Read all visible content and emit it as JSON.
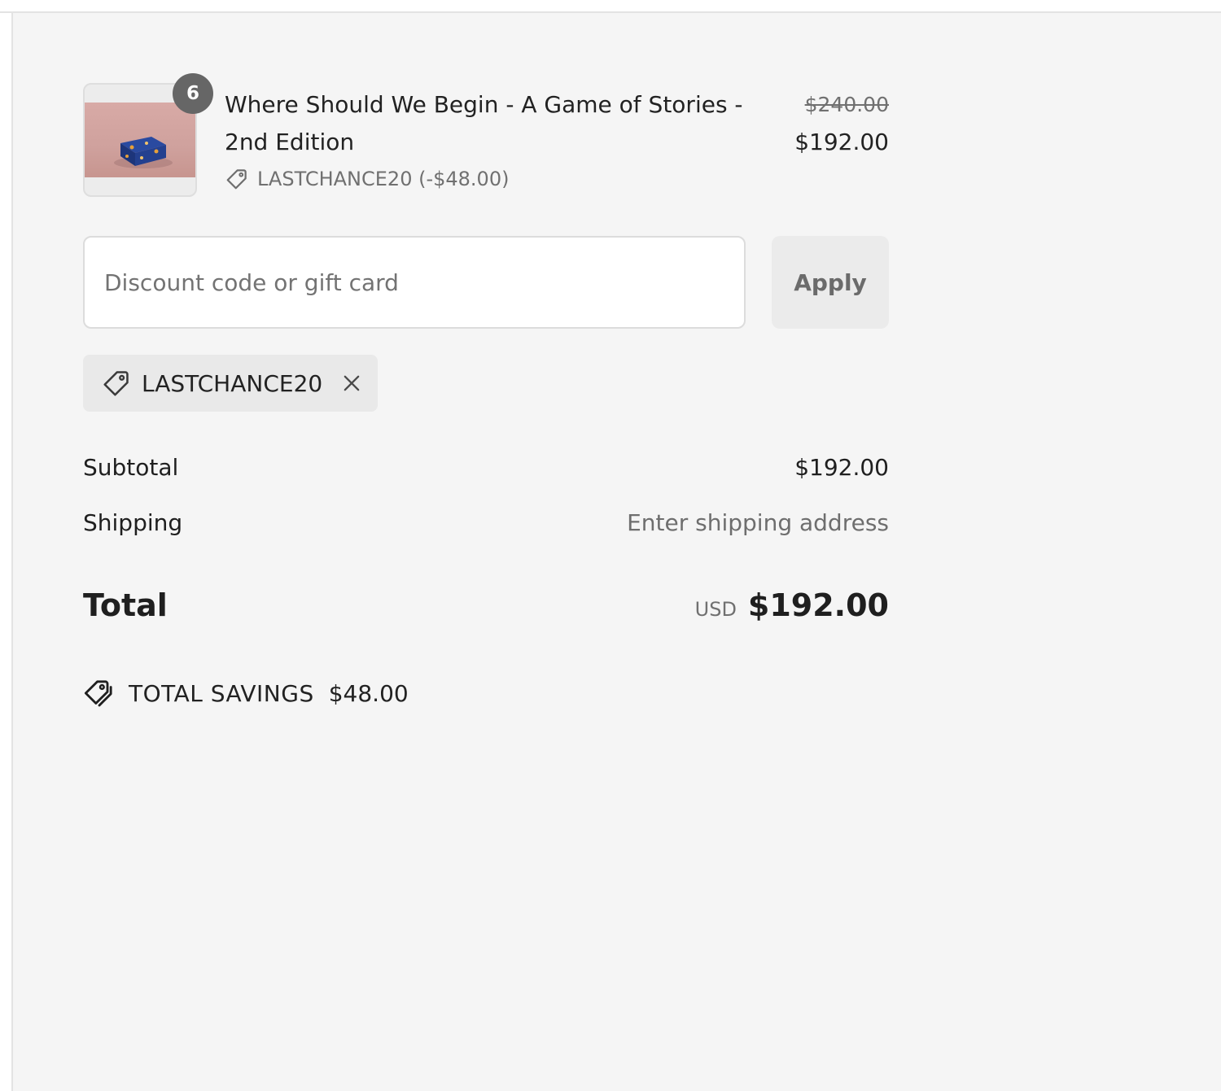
{
  "order_summary": {
    "line_item": {
      "quantity": "6",
      "title": "Where Should We Begin - A Game of Stories - 2nd Edition",
      "discount": "LASTCHANCE20 (-$48.00)",
      "original_price": "$240.00",
      "price": "$192.00",
      "icon": "tag-icon"
    },
    "discount": {
      "placeholder": "Discount code or gift card",
      "value": "",
      "apply_label": "Apply"
    },
    "applied_code": {
      "code": "LASTCHANCE20",
      "icon": "tag-icon",
      "remove_icon": "close-icon"
    },
    "subtotal": {
      "label": "Subtotal",
      "value": "$192.00"
    },
    "shipping": {
      "label": "Shipping",
      "value": "Enter shipping address"
    },
    "total": {
      "label": "Total",
      "currency": "USD",
      "value": "$192.00"
    },
    "savings": {
      "label": "TOTAL SAVINGS",
      "value": "$48.00",
      "icon": "tags-icon"
    }
  }
}
